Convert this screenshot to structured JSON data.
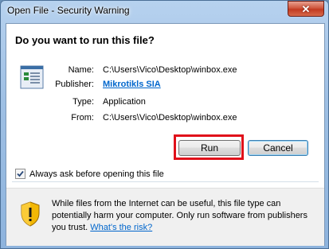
{
  "window": {
    "title": "Open File - Security Warning",
    "close_symbol": "✕"
  },
  "dialog": {
    "question": "Do you want to run this file?",
    "fields": [
      {
        "label": "Name:",
        "value": "C:\\Users\\Vico\\Desktop\\winbox.exe"
      },
      {
        "label": "Publisher:",
        "value": "Mikrotikls SIA"
      },
      {
        "label": "Type:",
        "value": "Application"
      },
      {
        "label": "From:",
        "value": "C:\\Users\\Vico\\Desktop\\winbox.exe"
      }
    ],
    "run_label": "Run",
    "cancel_label": "Cancel",
    "checkbox_label": "Always ask before opening this file",
    "checkbox_checked": true
  },
  "warning": {
    "text": "While files from the Internet can be useful, this file type can potentially harm your computer. Only run software from publishers you trust. ",
    "risk_link": "What's the risk?"
  },
  "icons": {
    "file": "application-file-icon",
    "shield": "shield-warning-icon",
    "close": "close-icon",
    "check": "checkmark-icon"
  },
  "colors": {
    "link": "#0066cc",
    "highlight": "#e0101a",
    "close_button": "#c23a21"
  }
}
